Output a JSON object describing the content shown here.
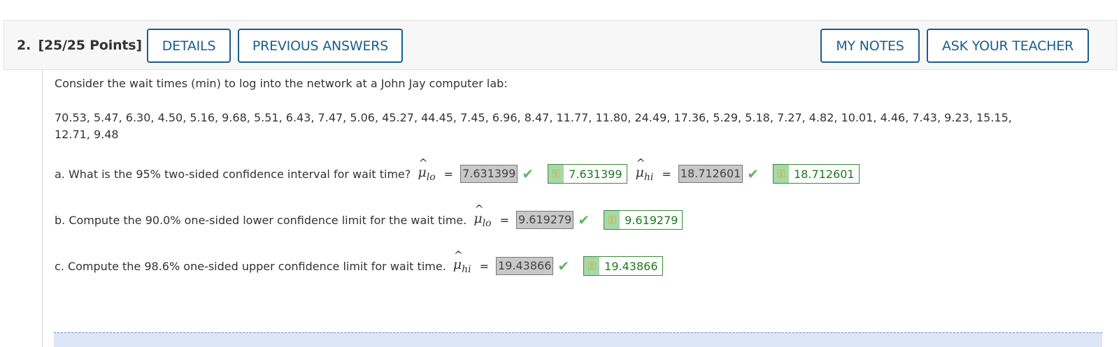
{
  "question": {
    "number": "2.",
    "points": "[25/25 Points]"
  },
  "header_buttons": {
    "details": "DETAILS",
    "previous_answers": "PREVIOUS ANSWERS",
    "my_notes": "MY NOTES",
    "ask_teacher": "ASK YOUR TEACHER"
  },
  "prompt": "Consider the wait times (min) to log into the network at a John Jay computer lab:",
  "data_line1": "70.53, 5.47, 6.30, 4.50, 5.16, 9.68, 5.51, 6.43, 7.47, 5.06, 45.27, 44.45, 7.45, 6.96, 8.47, 11.77, 11.80, 24.49, 17.36, 5.29, 5.18, 7.27, 4.82, 10.01, 4.46, 7.43, 9.23, 15.15,",
  "data_line2": "12.71, 9.48",
  "parts": {
    "a": {
      "text": "a. What is the 95% two-sided confidence interval for wait time?",
      "lo_sub": "lo",
      "lo_answer": "7.631399",
      "lo_key": "7.631399",
      "hi_sub": "hi",
      "hi_answer": "18.712601",
      "hi_key": "18.712601"
    },
    "b": {
      "text": "b. Compute the 90.0% one-sided lower confidence limit for the wait time.",
      "sub": "lo",
      "answer": "9.619279",
      "key": "9.619279"
    },
    "c": {
      "text": "c. Compute the 98.6% one-sided upper confidence limit for wait time.",
      "sub": "hi",
      "answer": "19.43866",
      "key": "19.43866"
    }
  },
  "symbols": {
    "mu": "μ",
    "hat": "^",
    "equals": "=",
    "check": "✔",
    "key": "⚿"
  },
  "colors": {
    "button_border": "#1a5e8a",
    "correct_green": "#5cb85c",
    "key_green": "#1c7a1c",
    "answer_bg": "#c8c8c8"
  }
}
